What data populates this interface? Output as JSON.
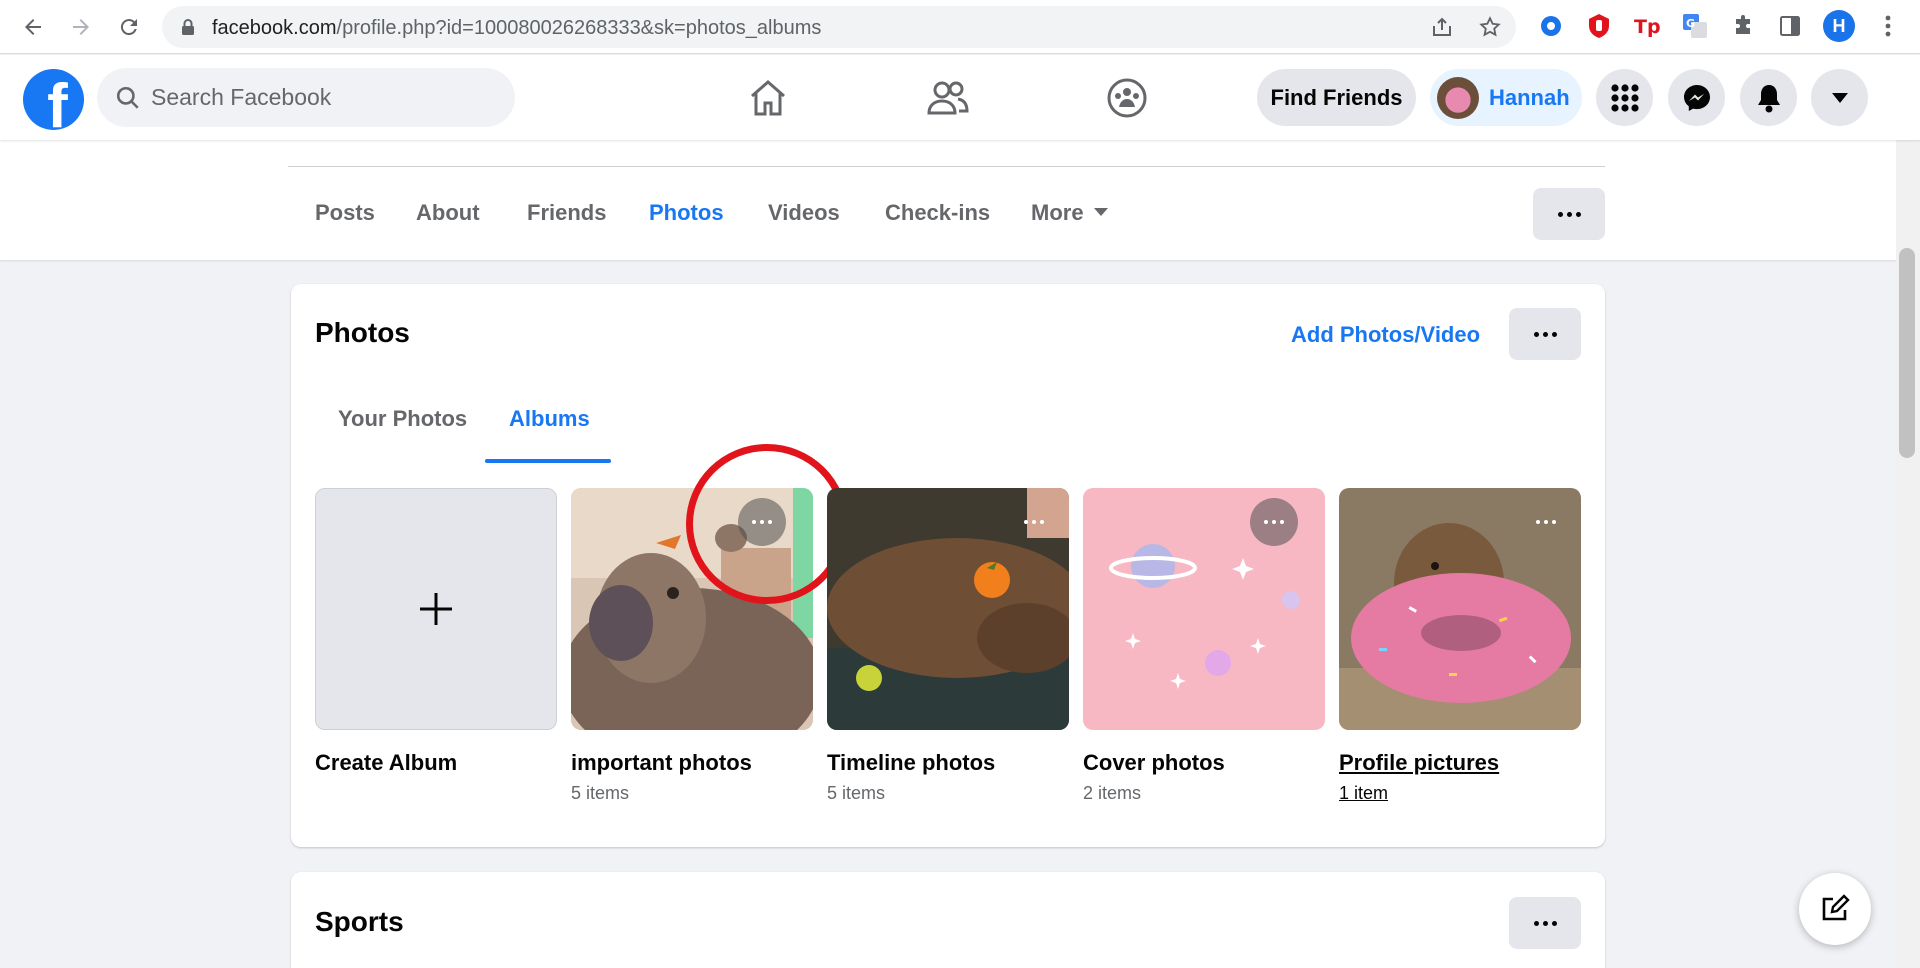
{
  "browser": {
    "url_host": "facebook.com",
    "url_path": "/profile.php?id=100080026268333&sk=photos_albums",
    "profile_initial": "H"
  },
  "fb": {
    "search_placeholder": "Search Facebook",
    "find_friends_label": "Find Friends",
    "profile_name": "Hannah"
  },
  "profile_tabs": {
    "items": [
      {
        "label": "Posts"
      },
      {
        "label": "About"
      },
      {
        "label": "Friends"
      },
      {
        "label": "Photos",
        "active": true
      },
      {
        "label": "Videos"
      },
      {
        "label": "Check-ins"
      },
      {
        "label": "More"
      }
    ]
  },
  "photos_section": {
    "title": "Photos",
    "add_label": "Add Photos/Video",
    "subtabs": [
      {
        "label": "Your Photos"
      },
      {
        "label": "Albums",
        "active": true
      }
    ],
    "albums": [
      {
        "title": "Create Album",
        "count": ""
      },
      {
        "title": "important photos",
        "count": "5 items"
      },
      {
        "title": "Timeline photos",
        "count": "5 items"
      },
      {
        "title": "Cover photos",
        "count": "2 items"
      },
      {
        "title": "Profile pictures",
        "count": "1 item"
      }
    ]
  },
  "sports_section": {
    "title": "Sports"
  },
  "colors": {
    "brand_blue": "#1877f2",
    "page_bg": "#f0f2f5",
    "highlight_red": "#e1141c"
  }
}
